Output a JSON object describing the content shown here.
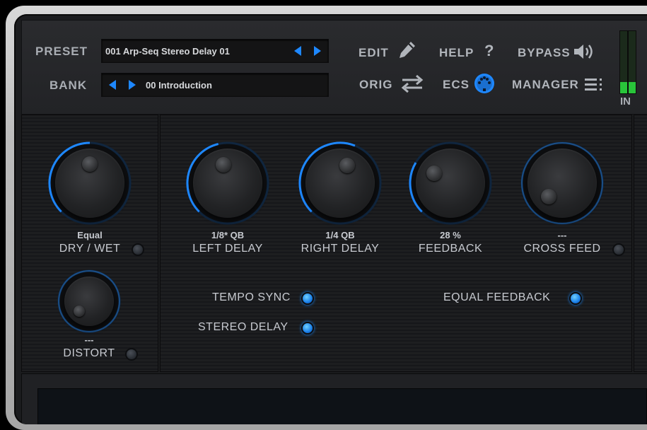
{
  "header": {
    "preset_label": "PRESET",
    "preset_value": "001 Arp-Seq Stereo Delay 01",
    "bank_label": "BANK",
    "bank_value": "00 Introduction",
    "edit_label": "EDIT",
    "help_label": "HELP",
    "help_glyph": "?",
    "bypass_label": "BYPASS",
    "orig_label": "ORIG",
    "ecs_label": "ECS",
    "manager_label": "MANAGER",
    "meter_label": "IN"
  },
  "meters": {
    "in_left_level": 0.18,
    "in_right_level": 0.18
  },
  "knobs": [
    {
      "id": "dry-wet",
      "value": "Equal",
      "label": "DRY / WET",
      "level": 0.5
    },
    {
      "id": "left-delay",
      "value": "1/8* QB",
      "label": "LEFT DELAY",
      "level": 0.45
    },
    {
      "id": "right-delay",
      "value": "1/4 QB",
      "label": "RIGHT  DELAY",
      "level": 0.58
    },
    {
      "id": "feedback",
      "value": "28 %",
      "label": "FEEDBACK",
      "level": 0.28
    },
    {
      "id": "cross-feed",
      "value": "---",
      "label": "CROSS FEED",
      "level": 0.0
    },
    {
      "id": "distort",
      "value": "---",
      "label": "DISTORT",
      "level": 0.0
    }
  ],
  "options": {
    "tempo_sync": "TEMPO SYNC",
    "stereo_delay": "STEREO DELAY",
    "equal_feedback": "EQUAL FEEDBACK"
  },
  "colors": {
    "accent": "#1e88ff",
    "meter_green": "#29c43a"
  },
  "icons": {
    "edit": "pencil-icon",
    "help": "question-mark-icon",
    "bypass": "speaker-icon",
    "orig": "swap-arrows-icon",
    "ecs": "midi-connector-icon",
    "manager": "list-icon"
  }
}
